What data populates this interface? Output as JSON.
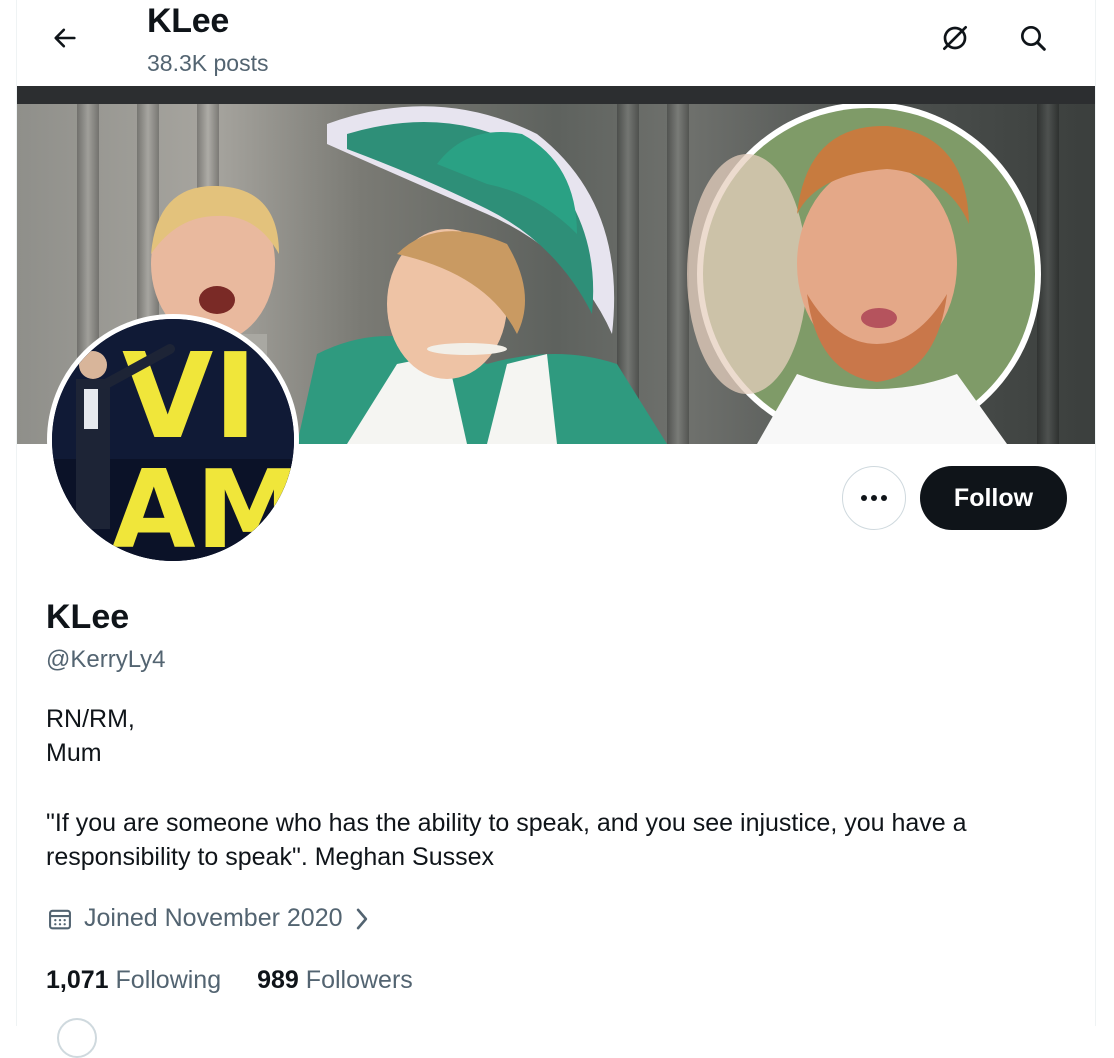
{
  "header": {
    "title": "KLee",
    "posts_count": "38.3K posts",
    "back_icon": "arrow-left-icon",
    "icons": [
      "circle-slash-icon",
      "search-icon"
    ]
  },
  "banner": {
    "description_icon": "banner-photo",
    "avatar_overlay": "profile-photo-circle"
  },
  "avatar_text": {
    "top": "VI",
    "bottom": "AM"
  },
  "actions": {
    "more_icon": "more-dots-icon",
    "follow_label": "Follow"
  },
  "profile": {
    "display_name": "KLee",
    "handle": "@KerryLy4",
    "bio_lines": [
      "RN/RM,",
      "Mum",
      "",
      "\"If you are someone who has the ability to speak, and you see injustice, you have a",
      "responsibility to speak\".  Meghan Sussex"
    ],
    "joined": "Joined November 2020"
  },
  "stats": {
    "following_count": "1,071",
    "following_label": "Following",
    "followers_count": "989",
    "followers_label": "Followers"
  },
  "colors": {
    "text": "#0f1419",
    "secondary": "#536471",
    "follow_bg": "#0f1419",
    "border": "#cfd9de"
  }
}
